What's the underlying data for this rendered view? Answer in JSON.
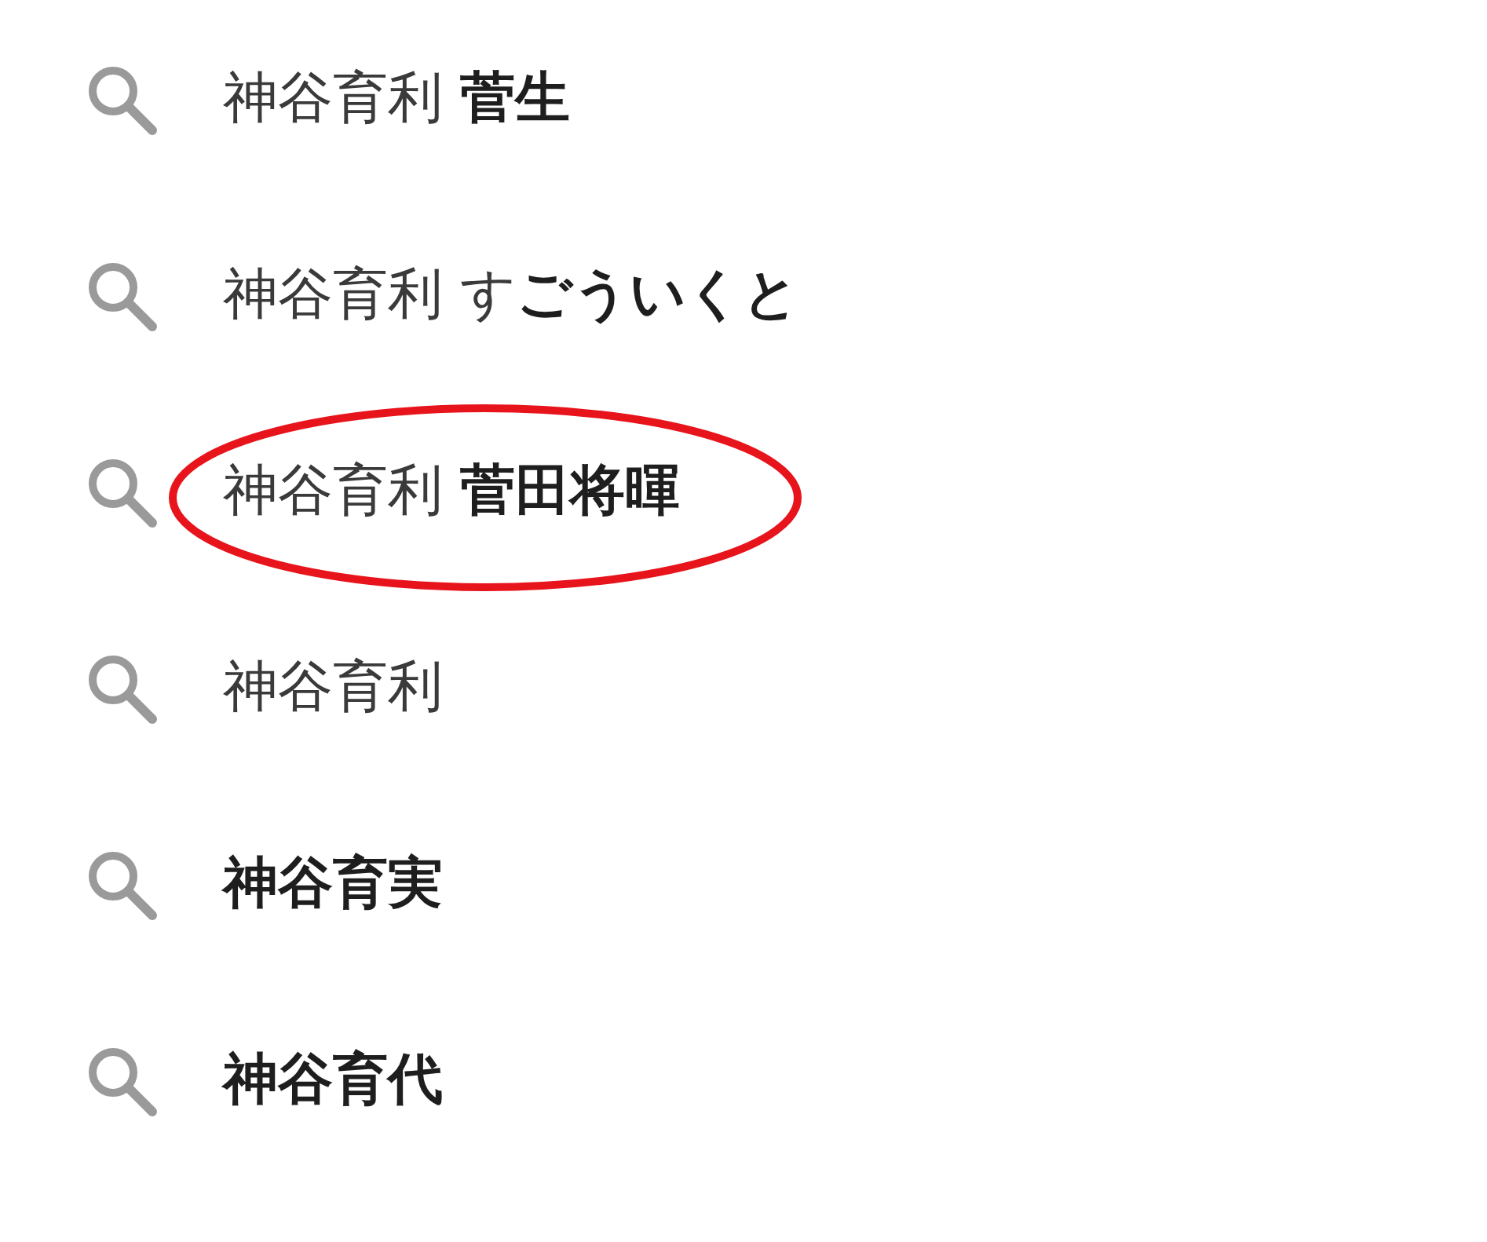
{
  "suggestions": [
    {
      "text": "神谷育利 **菅生**",
      "circled": false
    },
    {
      "text": "神谷育利 す**ごういくと**",
      "circled": false
    },
    {
      "text": "神谷育利 **菅田将暉**",
      "circled": true
    },
    {
      "text": "神谷育利",
      "circled": false
    },
    {
      "text": "**神谷育実**",
      "circled": false
    },
    {
      "text": "**神谷育代**",
      "circled": false
    }
  ]
}
